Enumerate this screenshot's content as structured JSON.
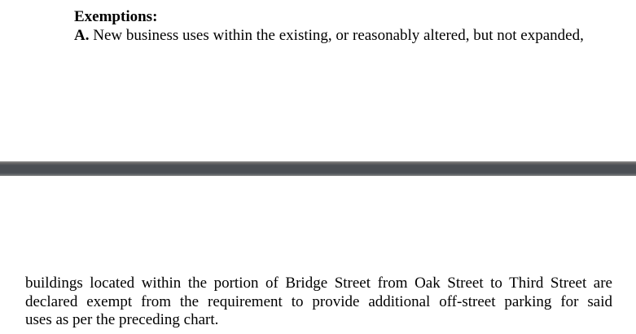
{
  "page1": {
    "heading": "Exemptions:",
    "item_marker": "A.",
    "item_text": " New business uses within the existing, or reasonably altered, but not expanded,"
  },
  "page2": {
    "lines": [
      "buildings located within the portion of Bridge Street from Oak Street to Third Street are",
      "declared exempt from the requirement to provide additional off-street parking for said",
      "uses as per the preceding chart."
    ]
  }
}
